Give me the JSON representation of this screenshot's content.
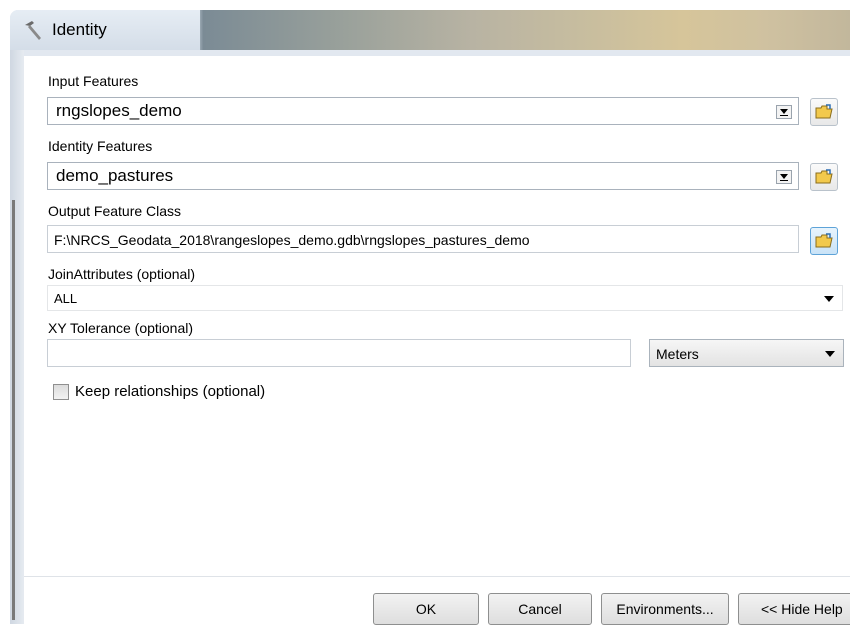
{
  "window": {
    "title": "Identity",
    "icon": "hammer-icon"
  },
  "fields": {
    "input_features": {
      "label": "Input Features",
      "value": "rngslopes_demo"
    },
    "identity_features": {
      "label": "Identity Features",
      "value": "demo_pastures"
    },
    "output_feature_class": {
      "label": "Output Feature Class",
      "value": "F:\\NRCS_Geodata_2018\\rangeslopes_demo.gdb\\rngslopes_pastures_demo"
    },
    "join_attributes": {
      "label": "JoinAttributes (optional)",
      "value": "ALL"
    },
    "xy_tolerance": {
      "label": "XY Tolerance (optional)",
      "value": "",
      "unit": "Meters"
    },
    "keep_relationships": {
      "label": "Keep relationships (optional)",
      "checked": false
    }
  },
  "buttons": {
    "ok": "OK",
    "cancel": "Cancel",
    "environments": "Environments...",
    "hide_help": "<< Hide Help"
  },
  "colors": {
    "folder_yellow": "#f2c94c",
    "active_button_border": "#5ea3d8"
  }
}
